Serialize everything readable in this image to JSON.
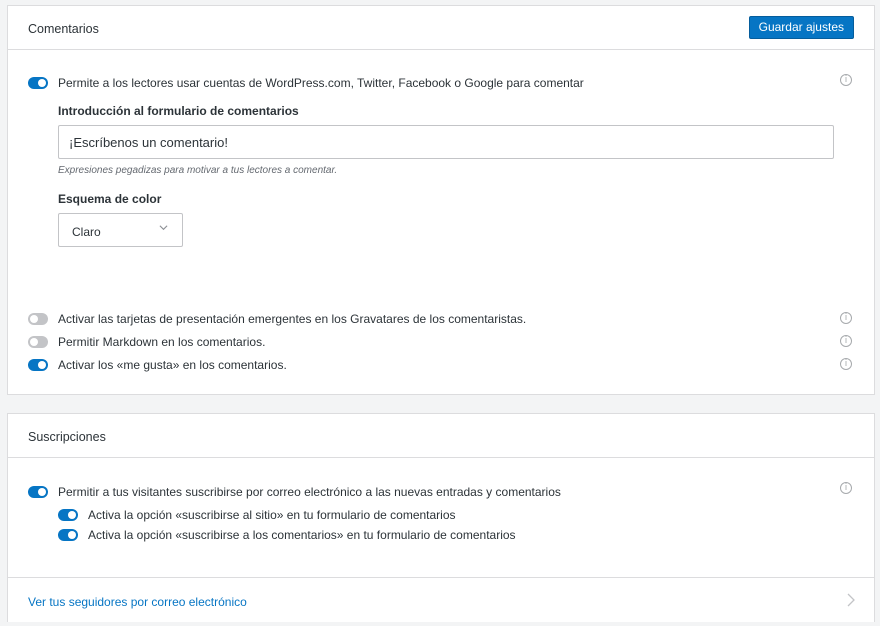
{
  "comments": {
    "title": "Comentarios",
    "save_label": "Guardar ajustes",
    "wpcom_toggle": {
      "label": "Permite a los lectores usar cuentas de WordPress.com, Twitter, Facebook o Google para comentar",
      "on": true
    },
    "intro_label": "Introducción al formulario de comentarios",
    "intro_value": "¡Escríbenos un comentario!",
    "intro_hint": "Expresiones pegadizas para motivar a tus lectores a comentar.",
    "scheme_label": "Esquema de color",
    "scheme_value": "Claro",
    "hovercards_toggle": {
      "label": "Activar las tarjetas de presentación emergentes en los Gravatares de los comentaristas.",
      "on": false
    },
    "markdown_toggle": {
      "label": "Permitir Markdown en los comentarios.",
      "on": false
    },
    "likes_toggle": {
      "label": "Activar los «me gusta» en los comentarios.",
      "on": true
    }
  },
  "subscriptions": {
    "title": "Suscripciones",
    "email_toggle": {
      "label": "Permitir a tus visitantes suscribirse por correo electrónico a las nuevas entradas y comentarios",
      "on": true
    },
    "site_toggle": {
      "label": "Activa la opción «suscribirse al sitio» en tu formulario de comentarios",
      "on": true
    },
    "comments_toggle": {
      "label": "Activa la opción «suscribirse a los comentarios» en tu formulario de comentarios",
      "on": true
    },
    "followers_link": "Ver tus seguidores por correo electrónico"
  },
  "icons": {
    "info": "info-icon",
    "chevron_down": "chevron-down-icon",
    "chevron_right": "chevron-right-icon"
  },
  "colors": {
    "accent": "#0675c4",
    "toggle_off": "#c3c4c7",
    "border": "#dcdcde"
  }
}
